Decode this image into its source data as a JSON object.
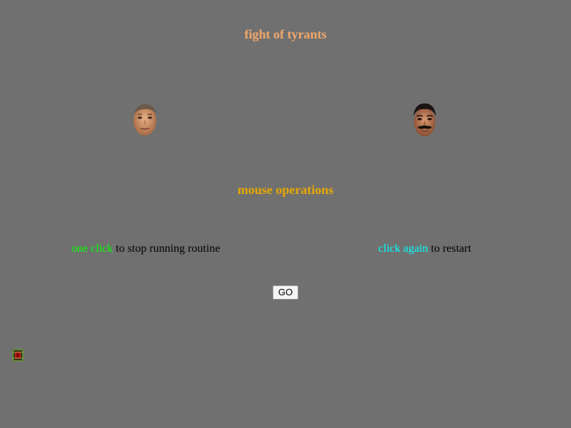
{
  "game": {
    "title": "fight of tyrants",
    "subtitle": "mouse operations",
    "instructions": {
      "left": {
        "highlight": "one click",
        "rest": " to stop running routine"
      },
      "right": {
        "highlight": "click again",
        "rest": " to restart"
      }
    },
    "go_label": "GO"
  },
  "colors": {
    "background": "#707070",
    "title": "#f4a869",
    "subtitle": "#e6a800",
    "highlight_left": "#00ff00",
    "highlight_right": "#00ffff",
    "instruction_text": "#000000"
  },
  "icons": {
    "left_fighter": "face-portrait-icon",
    "right_fighter": "face-portrait-icon",
    "game_token": "bomb-token-icon"
  }
}
